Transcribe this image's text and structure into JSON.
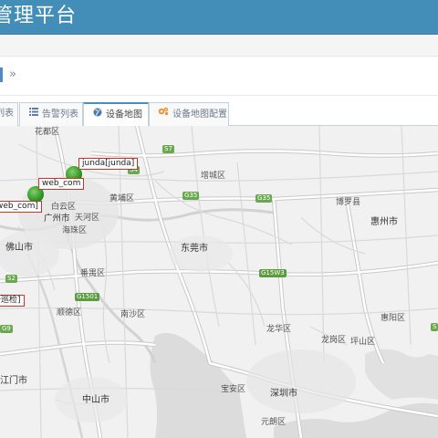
{
  "header": {
    "title": "管理平台"
  },
  "breadcrumb": {
    "separator": "»"
  },
  "tabs": [
    {
      "label": "列表",
      "icon": "list-icon",
      "active": false
    },
    {
      "label": "告警列表",
      "icon": "list-icon",
      "active": false
    },
    {
      "label": "设备地图",
      "icon": "globe-icon",
      "active": true
    },
    {
      "label": "设备地图配置",
      "icon": "cogs-icon",
      "active": false
    }
  ],
  "map": {
    "districts": [
      "花都区",
      "黄埔区",
      "增城区",
      "博罗县",
      "惠州市",
      "白云区",
      "广州市",
      "天河区",
      "海珠区",
      "佛山市",
      "东莞市",
      "番禺区",
      "顺德区",
      "南沙区",
      "惠阳区",
      "龙岗区",
      "坪山区",
      "龙华区",
      "宝安区",
      "深圳市",
      "江门市",
      "中山市",
      "元朗区"
    ],
    "highways": [
      "S7",
      "S4",
      "G35",
      "G35",
      "S2",
      "G15W3",
      "G1501",
      "G9",
      "S"
    ],
    "devices": [
      {
        "label": "junda[junda]"
      },
      {
        "label": "web_com"
      },
      {
        "label": "web_com]"
      },
      {
        "label": "备巡检]"
      }
    ],
    "marker_color": "#1f8a18"
  }
}
